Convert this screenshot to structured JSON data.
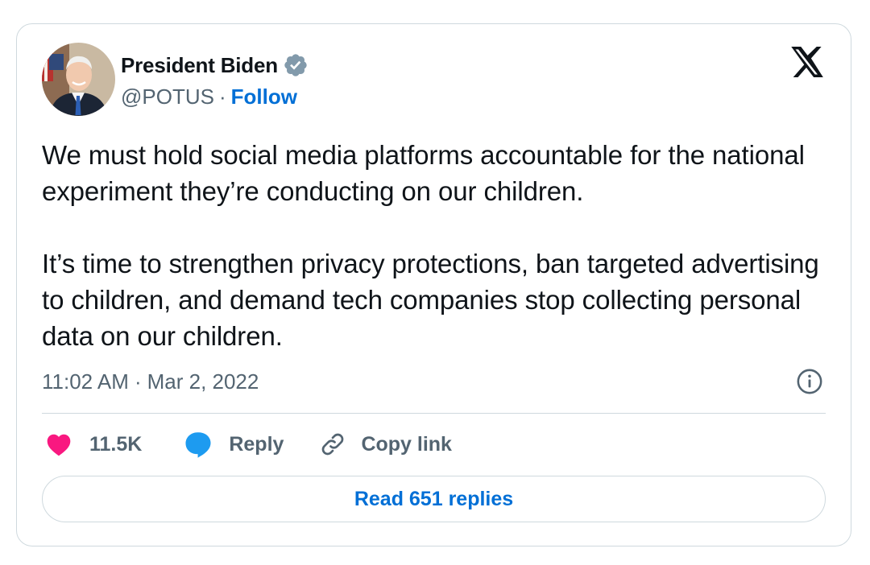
{
  "author": {
    "display_name": "President Biden",
    "handle": "@POTUS",
    "separator": "·",
    "follow_label": "Follow",
    "verified": true,
    "avatar_icon": "avatar-portrait"
  },
  "platform": {
    "logo_icon": "x-logo-icon"
  },
  "tweet": {
    "paragraphs": [
      "We must hold social media platforms accountable for the national experiment they’re conducting on our children.",
      "It’s time to strengthen privacy protections, ban targeted advertising to children, and demand tech companies stop collecting personal data on our children."
    ],
    "time": "11:02 AM",
    "separator": "·",
    "date": "Mar 2, 2022",
    "info_icon": "info-icon"
  },
  "actions": {
    "likes": {
      "icon": "heart-icon",
      "count": "11.5K"
    },
    "reply": {
      "icon": "speech-bubble-icon",
      "label": "Reply"
    },
    "copy": {
      "icon": "link-icon",
      "label": "Copy link"
    }
  },
  "replies": {
    "label": "Read 651 replies"
  },
  "colors": {
    "text_primary": "#0f1419",
    "text_secondary": "#536471",
    "link_blue": "#006fd6",
    "heart_pink": "#f91880",
    "reply_blue": "#1d9bf0",
    "verified_gray": "#829aab",
    "border": "#cfd9de"
  }
}
